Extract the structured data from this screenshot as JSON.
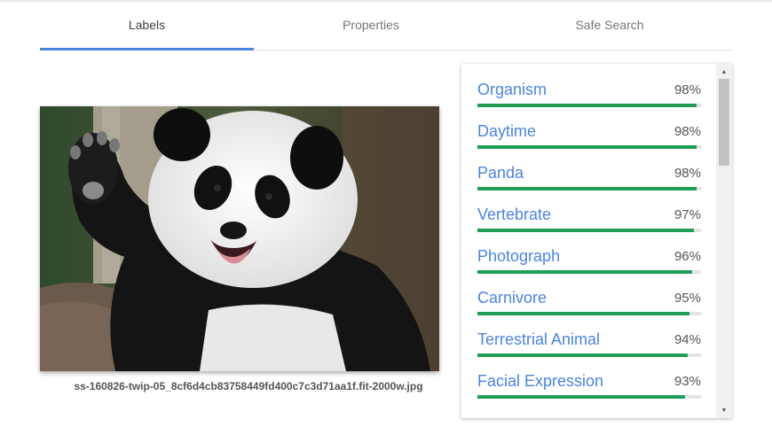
{
  "tabs": [
    {
      "label": "Labels",
      "active": true
    },
    {
      "label": "Properties",
      "active": false
    },
    {
      "label": "Safe Search",
      "active": false
    }
  ],
  "image": {
    "filename": "ss-160826-twip-05_8cf6d4cb83758449fd400c7c3d71aa1f.fit-2000w.jpg"
  },
  "labels": [
    {
      "name": "Organism",
      "score": "98%",
      "value": 98
    },
    {
      "name": "Daytime",
      "score": "98%",
      "value": 98
    },
    {
      "name": "Panda",
      "score": "98%",
      "value": 98
    },
    {
      "name": "Vertebrate",
      "score": "97%",
      "value": 97
    },
    {
      "name": "Photograph",
      "score": "96%",
      "value": 96
    },
    {
      "name": "Carnivore",
      "score": "95%",
      "value": 95
    },
    {
      "name": "Terrestrial Animal",
      "score": "94%",
      "value": 94
    },
    {
      "name": "Facial Expression",
      "score": "93%",
      "value": 93
    }
  ],
  "scrollbar": {
    "up_icon": "arrow-up-icon",
    "down_icon": "arrow-down-icon"
  },
  "colors": {
    "accent": "#4a84e3",
    "bar": "#1f9d55",
    "track": "#e3e3e3"
  }
}
